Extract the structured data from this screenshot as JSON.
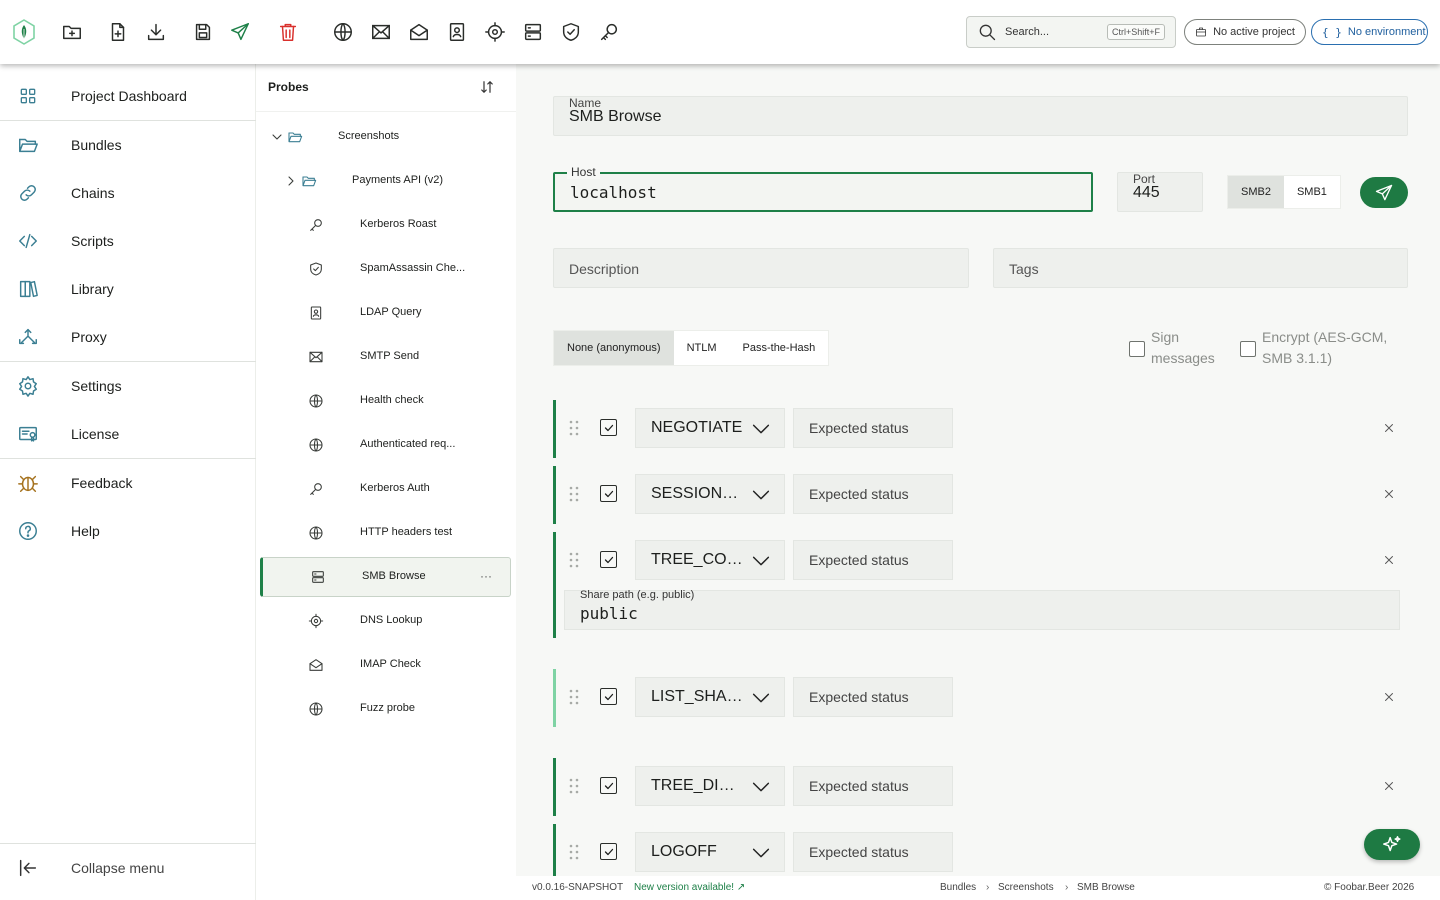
{
  "toolbar": {
    "buttons": [
      "new-folder",
      "new-file",
      "download",
      "save",
      "send",
      "delete",
      "http",
      "smtp",
      "imap",
      "ldap",
      "dns",
      "smb",
      "spamassassin",
      "kerberos"
    ],
    "search_placeholder": "Search...",
    "search_shortcut": "Ctrl+Shift+F",
    "project_label": "No active project",
    "environment_label": "No environment",
    "delete_color": "#d9302c",
    "brand_color": "#1e8048"
  },
  "sidebar": {
    "items": [
      {
        "label": "Project Dashboard",
        "icon": "grid-icon"
      },
      {
        "label": "Bundles",
        "icon": "folder-open-icon"
      },
      {
        "label": "Chains",
        "icon": "link-icon"
      },
      {
        "label": "Scripts",
        "icon": "code-icon"
      },
      {
        "label": "Library",
        "icon": "books-icon"
      },
      {
        "label": "Proxy",
        "icon": "proxy-icon"
      },
      {
        "label": "Settings",
        "icon": "gear-icon"
      },
      {
        "label": "License",
        "icon": "license-icon"
      },
      {
        "label": "Feedback",
        "icon": "bug-icon"
      },
      {
        "label": "Help",
        "icon": "help-icon"
      }
    ],
    "collapse_label": "Collapse menu"
  },
  "tree": {
    "title": "Probes",
    "items": [
      {
        "label": "Screenshots",
        "icon": "folder-icon",
        "level": 0,
        "expanded": true
      },
      {
        "label": "Payments API (v2)",
        "icon": "folder-icon",
        "level": 1,
        "expanded": false
      },
      {
        "label": "Kerberos Roast",
        "icon": "key-icon",
        "level": 2
      },
      {
        "label": "SpamAssassin Che...",
        "icon": "shield-icon",
        "level": 2
      },
      {
        "label": "LDAP Query",
        "icon": "contact-book-icon",
        "level": 2
      },
      {
        "label": "SMTP Send",
        "icon": "envelope-icon",
        "level": 2
      },
      {
        "label": "Health check",
        "icon": "globe-icon",
        "level": 2
      },
      {
        "label": "Authenticated req...",
        "icon": "globe-icon",
        "level": 2
      },
      {
        "label": "Kerberos Auth",
        "icon": "key-icon",
        "level": 2
      },
      {
        "label": "HTTP headers test",
        "icon": "globe-icon",
        "level": 2
      },
      {
        "label": "SMB Browse",
        "icon": "server-icon",
        "level": 2,
        "selected": true
      },
      {
        "label": "DNS Lookup",
        "icon": "target-icon",
        "level": 2
      },
      {
        "label": "IMAP Check",
        "icon": "envelope-open-icon",
        "level": 2
      },
      {
        "label": "Fuzz probe",
        "icon": "globe-icon",
        "level": 2
      }
    ],
    "more_label": "···"
  },
  "form": {
    "name_label": "Name",
    "name_value": "SMB Browse",
    "host_label": "Host",
    "host_value": "localhost",
    "port_label": "Port",
    "port_value": "445",
    "protocol_options": [
      "SMB2",
      "SMB1"
    ],
    "protocol_selected": "SMB2",
    "description_placeholder": "Description",
    "tags_placeholder": "Tags",
    "auth_options": [
      "None (anonymous)",
      "NTLM",
      "Pass-the-Hash"
    ],
    "auth_selected": "None (anonymous)",
    "sign_label": "Sign messages",
    "encrypt_label": "Encrypt (AES-GCM, SMB 3.1.1)",
    "sign_checked": false,
    "encrypt_checked": false
  },
  "steps": [
    {
      "command": "NEGOTIATE",
      "expected_placeholder": "Expected status",
      "enabled": true
    },
    {
      "command": "SESSION_SETUP",
      "expected_placeholder": "Expected status",
      "enabled": true
    },
    {
      "command": "TREE_CONNECT",
      "expected_placeholder": "Expected status",
      "enabled": true,
      "share_label": "Share path (e.g. public)",
      "share_value": "public"
    },
    {
      "command": "LIST_SHARES",
      "expected_placeholder": "Expected status",
      "enabled": true
    },
    {
      "command": "TREE_DISCONNECT",
      "expected_placeholder": "Expected status",
      "enabled": true
    },
    {
      "command": "LOGOFF",
      "expected_placeholder": "Expected status",
      "enabled": true
    }
  ],
  "footer": {
    "version": "v0.0.16-SNAPSHOT",
    "update_text": "New version available! ↗",
    "breadcrumb": [
      "Bundles",
      "Screenshots",
      "SMB Browse"
    ],
    "copyright": "© Foobar.Beer 2026"
  }
}
